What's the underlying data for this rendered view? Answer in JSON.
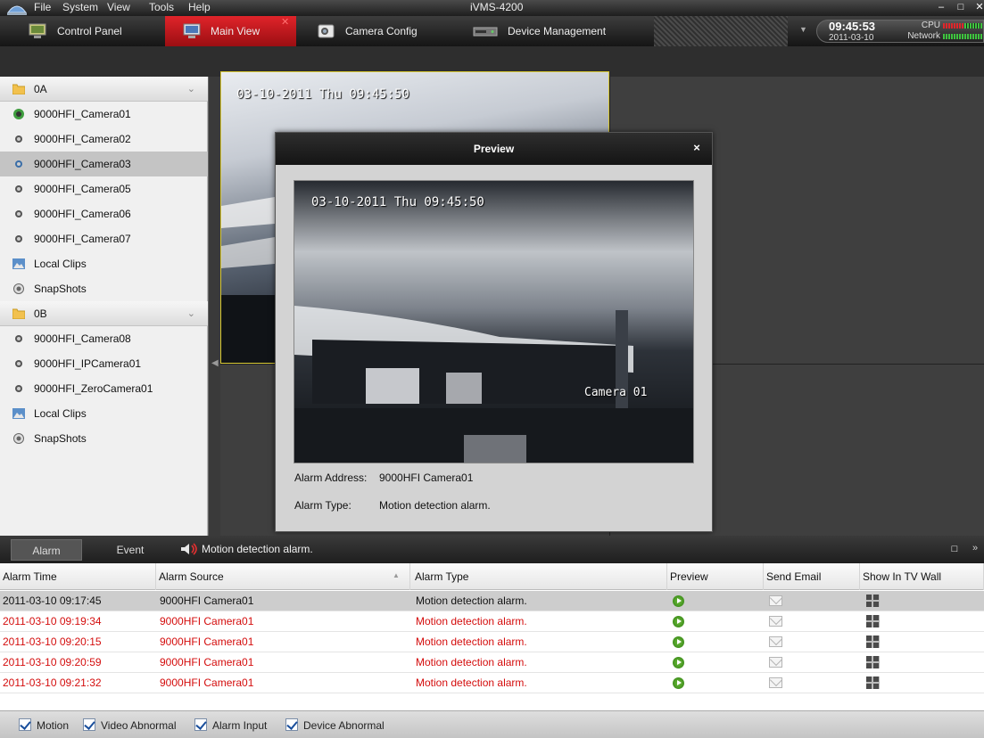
{
  "app": {
    "title": "iVMS-4200",
    "menu": [
      "File",
      "System",
      "View",
      "Tools",
      "Help"
    ]
  },
  "tabs": [
    {
      "label": "Control Panel",
      "icon": "control-panel-icon"
    },
    {
      "label": "Main View",
      "icon": "main-view-icon",
      "active": true
    },
    {
      "label": "Camera Config",
      "icon": "camera-config-icon"
    },
    {
      "label": "Device Management",
      "icon": "device-management-icon"
    }
  ],
  "status": {
    "time": "09:45:53",
    "date": "2011-03-10",
    "cpu_label": "CPU",
    "network_label": "Network"
  },
  "tree": [
    {
      "label": "0A",
      "type": "group",
      "icon": "folder-icon"
    },
    {
      "label": "9000HFI_Camera01",
      "type": "camera",
      "icon": "camera-active-icon"
    },
    {
      "label": "9000HFI_Camera02",
      "type": "camera",
      "icon": "camera-icon"
    },
    {
      "label": "9000HFI_Camera03",
      "type": "camera",
      "icon": "camera-icon",
      "selected": true
    },
    {
      "label": "9000HFI_Camera05",
      "type": "camera",
      "icon": "camera-icon"
    },
    {
      "label": "9000HFI_Camera06",
      "type": "camera",
      "icon": "camera-icon"
    },
    {
      "label": "9000HFI_Camera07",
      "type": "camera",
      "icon": "camera-icon"
    },
    {
      "label": "Local Clips",
      "type": "item",
      "icon": "local-clips-icon"
    },
    {
      "label": "SnapShots",
      "type": "item",
      "icon": "snapshots-icon"
    },
    {
      "label": "0B",
      "type": "group",
      "icon": "folder-icon"
    },
    {
      "label": "9000HFI_Camera08",
      "type": "camera",
      "icon": "camera-icon"
    },
    {
      "label": "9000HFI_IPCamera01",
      "type": "camera",
      "icon": "camera-icon"
    },
    {
      "label": "9000HFI_ZeroCamera01",
      "type": "camera",
      "icon": "camera-icon"
    },
    {
      "label": "Local Clips",
      "type": "item",
      "icon": "local-clips-icon"
    },
    {
      "label": "SnapShots",
      "type": "item",
      "icon": "snapshots-icon"
    }
  ],
  "video": {
    "osd_timestamp": "03-10-2011 Thu 09:45:50"
  },
  "preview": {
    "title": "Preview",
    "close": "×",
    "osd_timestamp": "03-10-2011 Thu 09:45:50",
    "osd_camera": "Camera 01",
    "address_label": "Alarm Address:",
    "address_value": "9000HFI Camera01",
    "type_label": "Alarm Type:",
    "type_value": "Motion detection alarm."
  },
  "alarm_panel": {
    "tab_alarm": "Alarm",
    "tab_event": "Event",
    "message": "Motion detection alarm.",
    "columns": [
      "Alarm Time",
      "Alarm Source",
      "Alarm Type",
      "Preview",
      "Send Email",
      "Show In TV Wall"
    ],
    "rows": [
      {
        "time": "2011-03-10 09:17:45",
        "source": "9000HFI Camera01",
        "type": "Motion detection alarm."
      },
      {
        "time": "2011-03-10 09:19:34",
        "source": "9000HFI Camera01",
        "type": "Motion detection alarm."
      },
      {
        "time": "2011-03-10 09:20:15",
        "source": "9000HFI Camera01",
        "type": "Motion detection alarm."
      },
      {
        "time": "2011-03-10 09:20:59",
        "source": "9000HFI Camera01",
        "type": "Motion detection alarm."
      },
      {
        "time": "2011-03-10 09:21:32",
        "source": "9000HFI Camera01",
        "type": "Motion detection alarm."
      }
    ]
  },
  "filters": [
    {
      "label": "Motion",
      "checked": true
    },
    {
      "label": "Video Abnormal",
      "checked": true
    },
    {
      "label": "Alarm Input",
      "checked": true
    },
    {
      "label": "Device Abnormal",
      "checked": true
    }
  ],
  "colors": {
    "active_tab": "#c8161c",
    "alarm_red": "#d40d0d",
    "tile_border": "#d8c832"
  }
}
